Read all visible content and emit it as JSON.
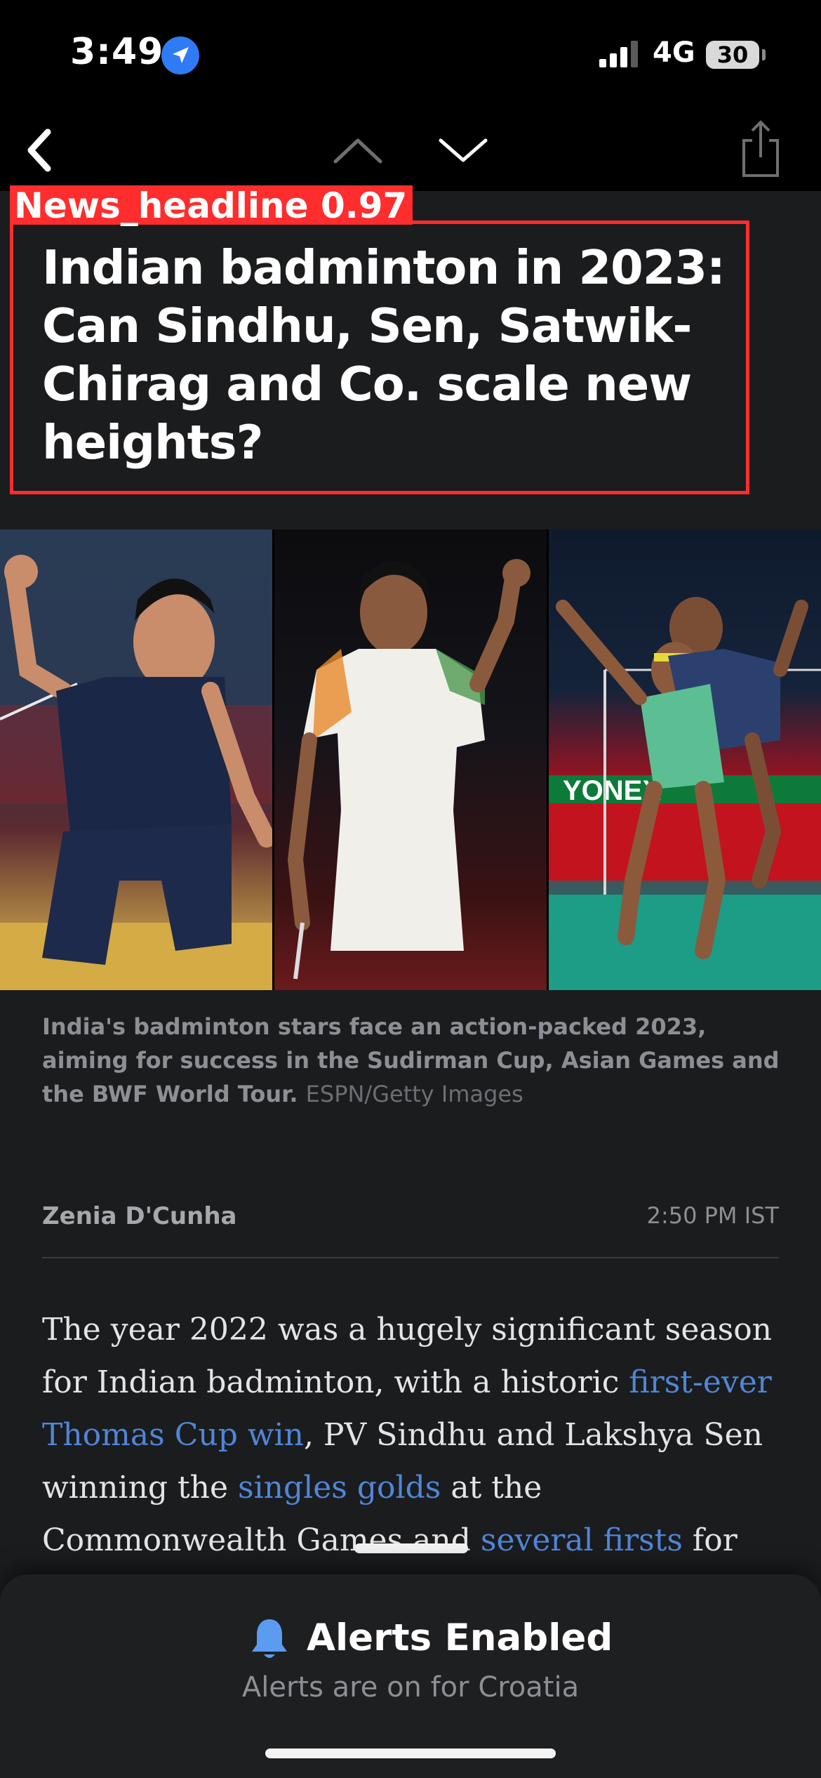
{
  "status_bar": {
    "time": "3:49",
    "network": "4G",
    "battery": "30",
    "icons": [
      "location-arrow-icon",
      "cellular-signal-icon",
      "battery-icon"
    ]
  },
  "nav_bar": {
    "icons": [
      "back-chevron-icon",
      "chevron-up-icon",
      "chevron-down-icon",
      "share-icon"
    ]
  },
  "detection": {
    "label": "News_headline  0.97",
    "color": "#ff2d2d"
  },
  "article": {
    "headline": "Indian badminton in 2023: Can Sindhu, Sen, Satwik-Chirag and Co. scale new heights?",
    "image_caption": "India's badminton stars face an action-packed 2023, aiming for success in the Sudirman Cup, Asian Games and the BWF World Tour.",
    "image_credit": "ESPN/Getty Images",
    "author": "Zenia D'Cunha",
    "timestamp": "2:50 PM IST",
    "body": {
      "t1": "The year 2022 was a hugely significant season for Indian badminton, with a historic ",
      "link1": "first-ever Thomas Cup win",
      "t2": ", PV Sindhu and Lakshya Sen winning the ",
      "link2": "singles golds",
      "t3": " at the Commonwealth Games and ",
      "link3": "several firsts",
      "t4": " for the men's doubles"
    },
    "link_color": "#4f86d8"
  },
  "alert": {
    "icon": "bell-icon",
    "title": "Alerts Enabled",
    "subtitle": "Alerts are on for Croatia",
    "icon_color": "#5b9cf0"
  }
}
